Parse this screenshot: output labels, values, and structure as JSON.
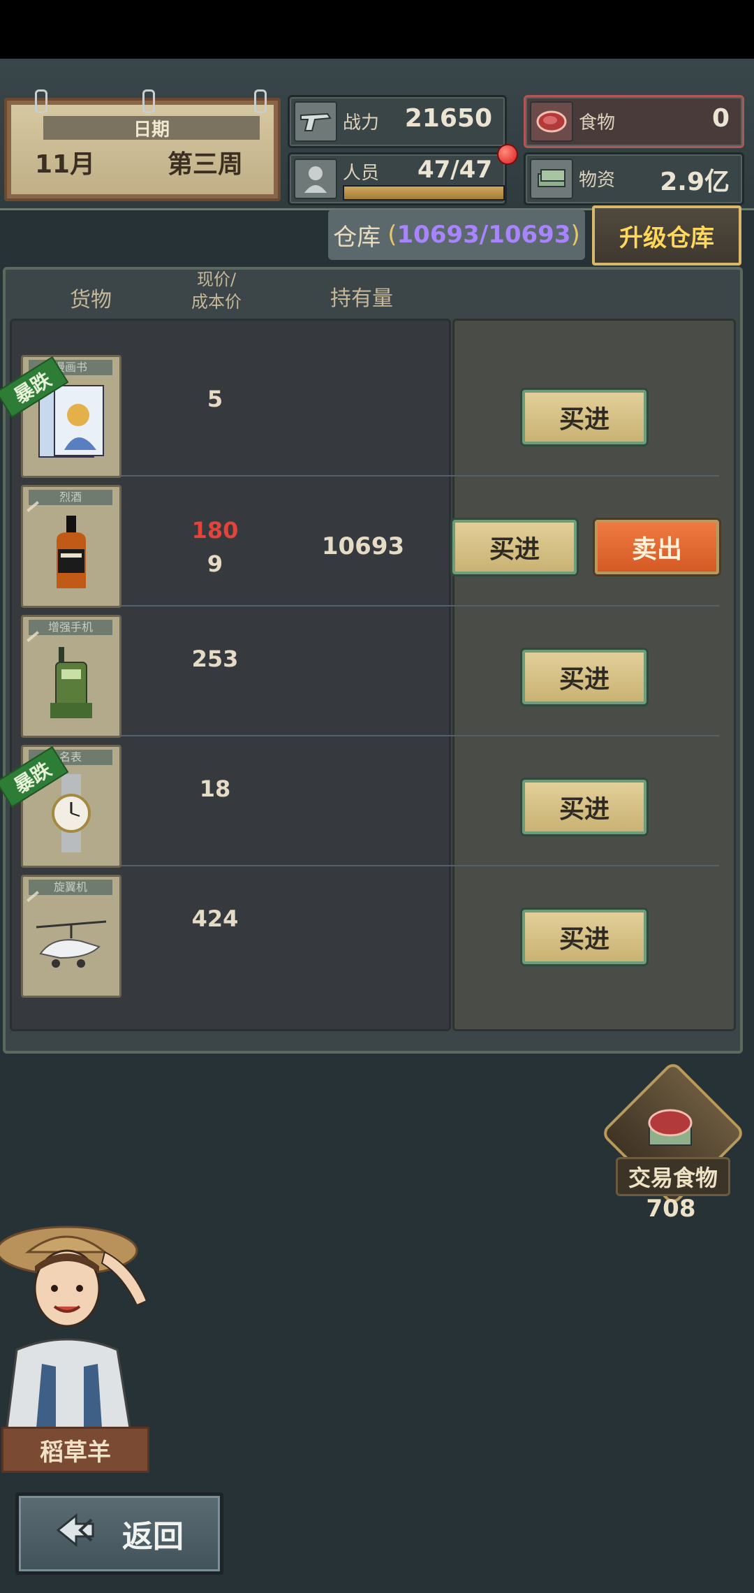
{
  "header": {
    "date_label": "日期",
    "month": "11月",
    "week": "第三周"
  },
  "stats": {
    "combat": {
      "label": "战力",
      "value": "21650",
      "icon": "pistol-icon"
    },
    "food": {
      "label": "食物",
      "value": "0",
      "icon": "meat-icon"
    },
    "staff": {
      "label": "人员",
      "value": "47/47",
      "icon": "person-icon",
      "progress": 1.0
    },
    "supplies": {
      "label": "物资",
      "value": "2.9亿",
      "icon": "cash-stack-icon"
    }
  },
  "warehouse": {
    "label": "仓库",
    "open_paren": "(",
    "usage": "10693/10693",
    "close_paren": ")",
    "upgrade_label": "升级仓库"
  },
  "table": {
    "col_goods": "货物",
    "col_price_line1": "现价/",
    "col_price_line2": "成本价",
    "col_holding": "持有量",
    "items": [
      {
        "name": "漫画书",
        "icon": "comic-book-icon",
        "tag": "暴跌",
        "price": "5",
        "cost": "",
        "holding": "",
        "buy": "买进",
        "sell": ""
      },
      {
        "name": "烈酒",
        "icon": "whiskey-bottle-icon",
        "tag": "",
        "price": "180",
        "cost": "9",
        "holding": "10693",
        "buy": "买进",
        "sell": "卖出"
      },
      {
        "name": "增强手机",
        "icon": "radio-phone-icon",
        "tag": "",
        "price": "253",
        "cost": "",
        "holding": "",
        "buy": "买进",
        "sell": ""
      },
      {
        "name": "名表",
        "icon": "wristwatch-icon",
        "tag": "暴跌",
        "price": "18",
        "cost": "",
        "holding": "",
        "buy": "买进",
        "sell": ""
      },
      {
        "name": "旋翼机",
        "icon": "gyrocopter-icon",
        "tag": "",
        "price": "424",
        "cost": "",
        "holding": "",
        "buy": "买进",
        "sell": ""
      }
    ]
  },
  "trade": {
    "label": "交易食物",
    "count": "708",
    "icon": "meat-trade-icon"
  },
  "npc": {
    "name": "稻草羊"
  },
  "back": {
    "label": "返回"
  },
  "colors": {
    "price_up": "#e0443a",
    "warehouse_number": "#a884ff",
    "upgrade_text": "#ffd75a",
    "crash_tag": "#2e7d37"
  }
}
